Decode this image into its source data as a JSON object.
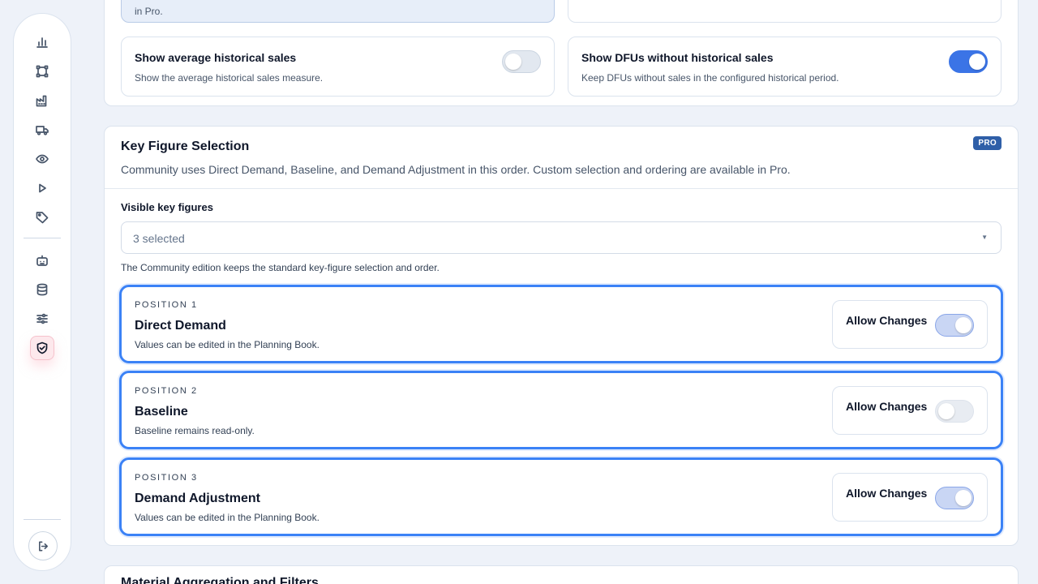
{
  "sidebar": {
    "items": [
      {
        "icon": "bar-chart-icon",
        "active": false
      },
      {
        "icon": "network-icon",
        "active": false
      },
      {
        "icon": "factory-icon",
        "active": false
      },
      {
        "icon": "truck-icon",
        "active": false
      },
      {
        "icon": "eye-icon",
        "active": false
      },
      {
        "icon": "play-icon",
        "active": false
      },
      {
        "icon": "tag-icon",
        "active": false
      },
      {
        "icon": "robot-icon",
        "active": false
      },
      {
        "icon": "database-icon",
        "active": false
      },
      {
        "icon": "sliders-icon",
        "active": false
      },
      {
        "icon": "shield-check-icon",
        "active": true
      }
    ],
    "logout_icon": "logout-icon"
  },
  "top_partial": {
    "left_text": "in Pro."
  },
  "options": {
    "avg_sales": {
      "title": "Show average historical sales",
      "description": "Show the average historical sales measure.",
      "enabled": false
    },
    "dfus_without_sales": {
      "title": "Show DFUs without historical sales",
      "description": "Keep DFUs without sales in the configured historical period.",
      "enabled": true
    }
  },
  "key_figures": {
    "title": "Key Figure Selection",
    "badge": "PRO",
    "description": "Community uses Direct Demand, Baseline, and Demand Adjustment in this order. Custom selection and ordering are available in Pro.",
    "field_label": "Visible key figures",
    "select_value": "3 selected",
    "helper": "The Community edition keeps the standard key-figure selection and order.",
    "allow_label": "Allow Changes",
    "positions": [
      {
        "label": "POSITION 1",
        "name": "Direct Demand",
        "description": "Values can be edited in the Planning Book.",
        "allow_changes": true
      },
      {
        "label": "POSITION 2",
        "name": "Baseline",
        "description": "Baseline remains read-only.",
        "allow_changes": false
      },
      {
        "label": "POSITION 3",
        "name": "Demand Adjustment",
        "description": "Values can be edited in the Planning Book.",
        "allow_changes": true
      }
    ]
  },
  "next_section": {
    "title": "Material Aggregation and Filters"
  },
  "colors": {
    "accent": "#3b74e6",
    "pro_badge": "#2f5fa8",
    "active_nav": "#fde8ec"
  }
}
